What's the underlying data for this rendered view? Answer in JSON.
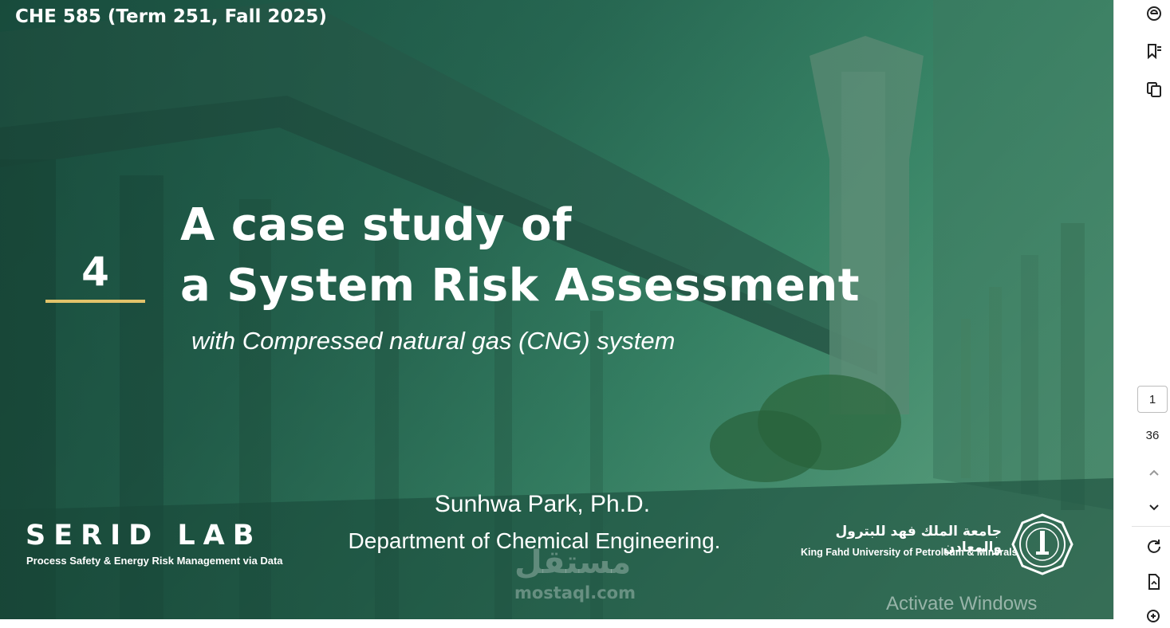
{
  "slide": {
    "course_title": "CHE 585 (Term 251, Fall 2025)",
    "chapter_number": "4",
    "title_line_1": "A case study of",
    "title_line_2": "a System Risk Assessment",
    "subtitle": "with Compressed natural gas (CNG) system",
    "presenter": "Sunhwa Park, Ph.D.",
    "department": "Department of Chemical Engineering.",
    "lab_logo": "SERID LAB",
    "lab_tagline": "Process Safety & Energy Risk Management via Data",
    "university_arabic": "جامعة الملك فهد للبترول والمعادن",
    "university_english": "King Fahd University of Petroleum & Minerals",
    "accent_color": "#e2c36a"
  },
  "watermark": {
    "arabic": "مستقل",
    "latin": "mostaql.com"
  },
  "os_overlay": {
    "activate_text": "Activate Windows"
  },
  "toolbar": {
    "icons": [
      "ai-assistant-icon",
      "bookmark-list-icon",
      "copy-pages-icon",
      "chevron-up-icon",
      "chevron-down-icon",
      "refresh-icon",
      "file-export-icon",
      "zoom-in-icon"
    ],
    "page_current": "1",
    "page_total": "36"
  }
}
